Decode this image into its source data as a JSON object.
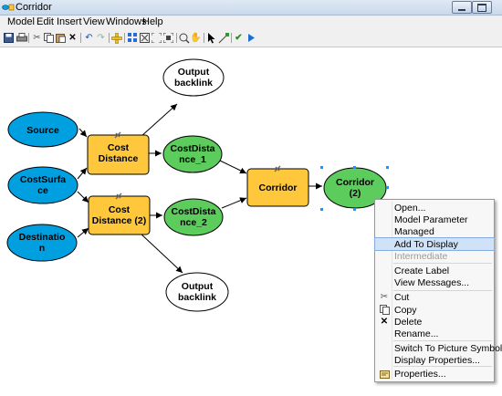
{
  "window": {
    "title": "Corridor"
  },
  "menu": [
    "Model",
    "Edit",
    "Insert",
    "View",
    "Windows",
    "Help"
  ],
  "toolbar": {
    "icons": [
      "save-icon",
      "print-icon",
      "cut-icon",
      "copy-icon",
      "paste-icon",
      "delete-icon",
      "undo-icon",
      "redo-icon",
      "add-data-icon",
      "auto-layout-icon",
      "full-extent-icon",
      "zoom-fit-icon",
      "zoom-in-icon",
      "pan-icon",
      "select-icon",
      "connect-icon",
      "validate-icon",
      "run-icon"
    ]
  },
  "diagram": {
    "nodes": {
      "source": "Source",
      "costsurface": "CostSurfa\nce",
      "destination": "Destinatio\nn",
      "cost_distance": "Cost\nDistance",
      "cost_distance_2": "Cost\nDistance (2)",
      "costdistance_1": "CostDista\nnce_1",
      "costdistance_2": "CostDista\nnce_2",
      "corridor_tool": "Corridor",
      "corridor_output": "Corridor\n(2)",
      "output_backlink_1": "Output\nbacklink",
      "output_backlink_2": "Output\nbacklink"
    },
    "colors": {
      "input_blue": "#00a0e0",
      "tool_yellow": "#ffc83c",
      "derived_green": "#5ccc5c",
      "output_white": "#ffffff",
      "selection": "#1e90ff"
    }
  },
  "context_menu": {
    "items": [
      {
        "label": "Open...",
        "icon": "",
        "enabled": true,
        "highlighted": false
      },
      {
        "label": "Model Parameter",
        "icon": "",
        "enabled": true,
        "highlighted": false
      },
      {
        "label": "Managed",
        "icon": "",
        "enabled": true,
        "highlighted": false
      },
      {
        "label": "Add To Display",
        "icon": "",
        "enabled": true,
        "highlighted": true
      },
      {
        "label": "Intermediate",
        "icon": "",
        "enabled": false,
        "highlighted": false
      },
      {
        "label": "Create Label",
        "icon": "",
        "enabled": true,
        "highlighted": false
      },
      {
        "label": "View Messages...",
        "icon": "",
        "enabled": true,
        "highlighted": false
      },
      {
        "label": "Cut",
        "icon": "cut-icon",
        "enabled": true,
        "highlighted": false
      },
      {
        "label": "Copy",
        "icon": "copy-icon",
        "enabled": true,
        "highlighted": false
      },
      {
        "label": "Delete",
        "icon": "delete-icon",
        "enabled": true,
        "highlighted": false
      },
      {
        "label": "Rename...",
        "icon": "",
        "enabled": true,
        "highlighted": false
      },
      {
        "label": "Switch To Picture Symbol",
        "icon": "",
        "enabled": true,
        "highlighted": false
      },
      {
        "label": "Display Properties...",
        "icon": "",
        "enabled": true,
        "highlighted": false
      },
      {
        "label": "Properties...",
        "icon": "properties-icon",
        "enabled": true,
        "highlighted": false
      }
    ]
  }
}
